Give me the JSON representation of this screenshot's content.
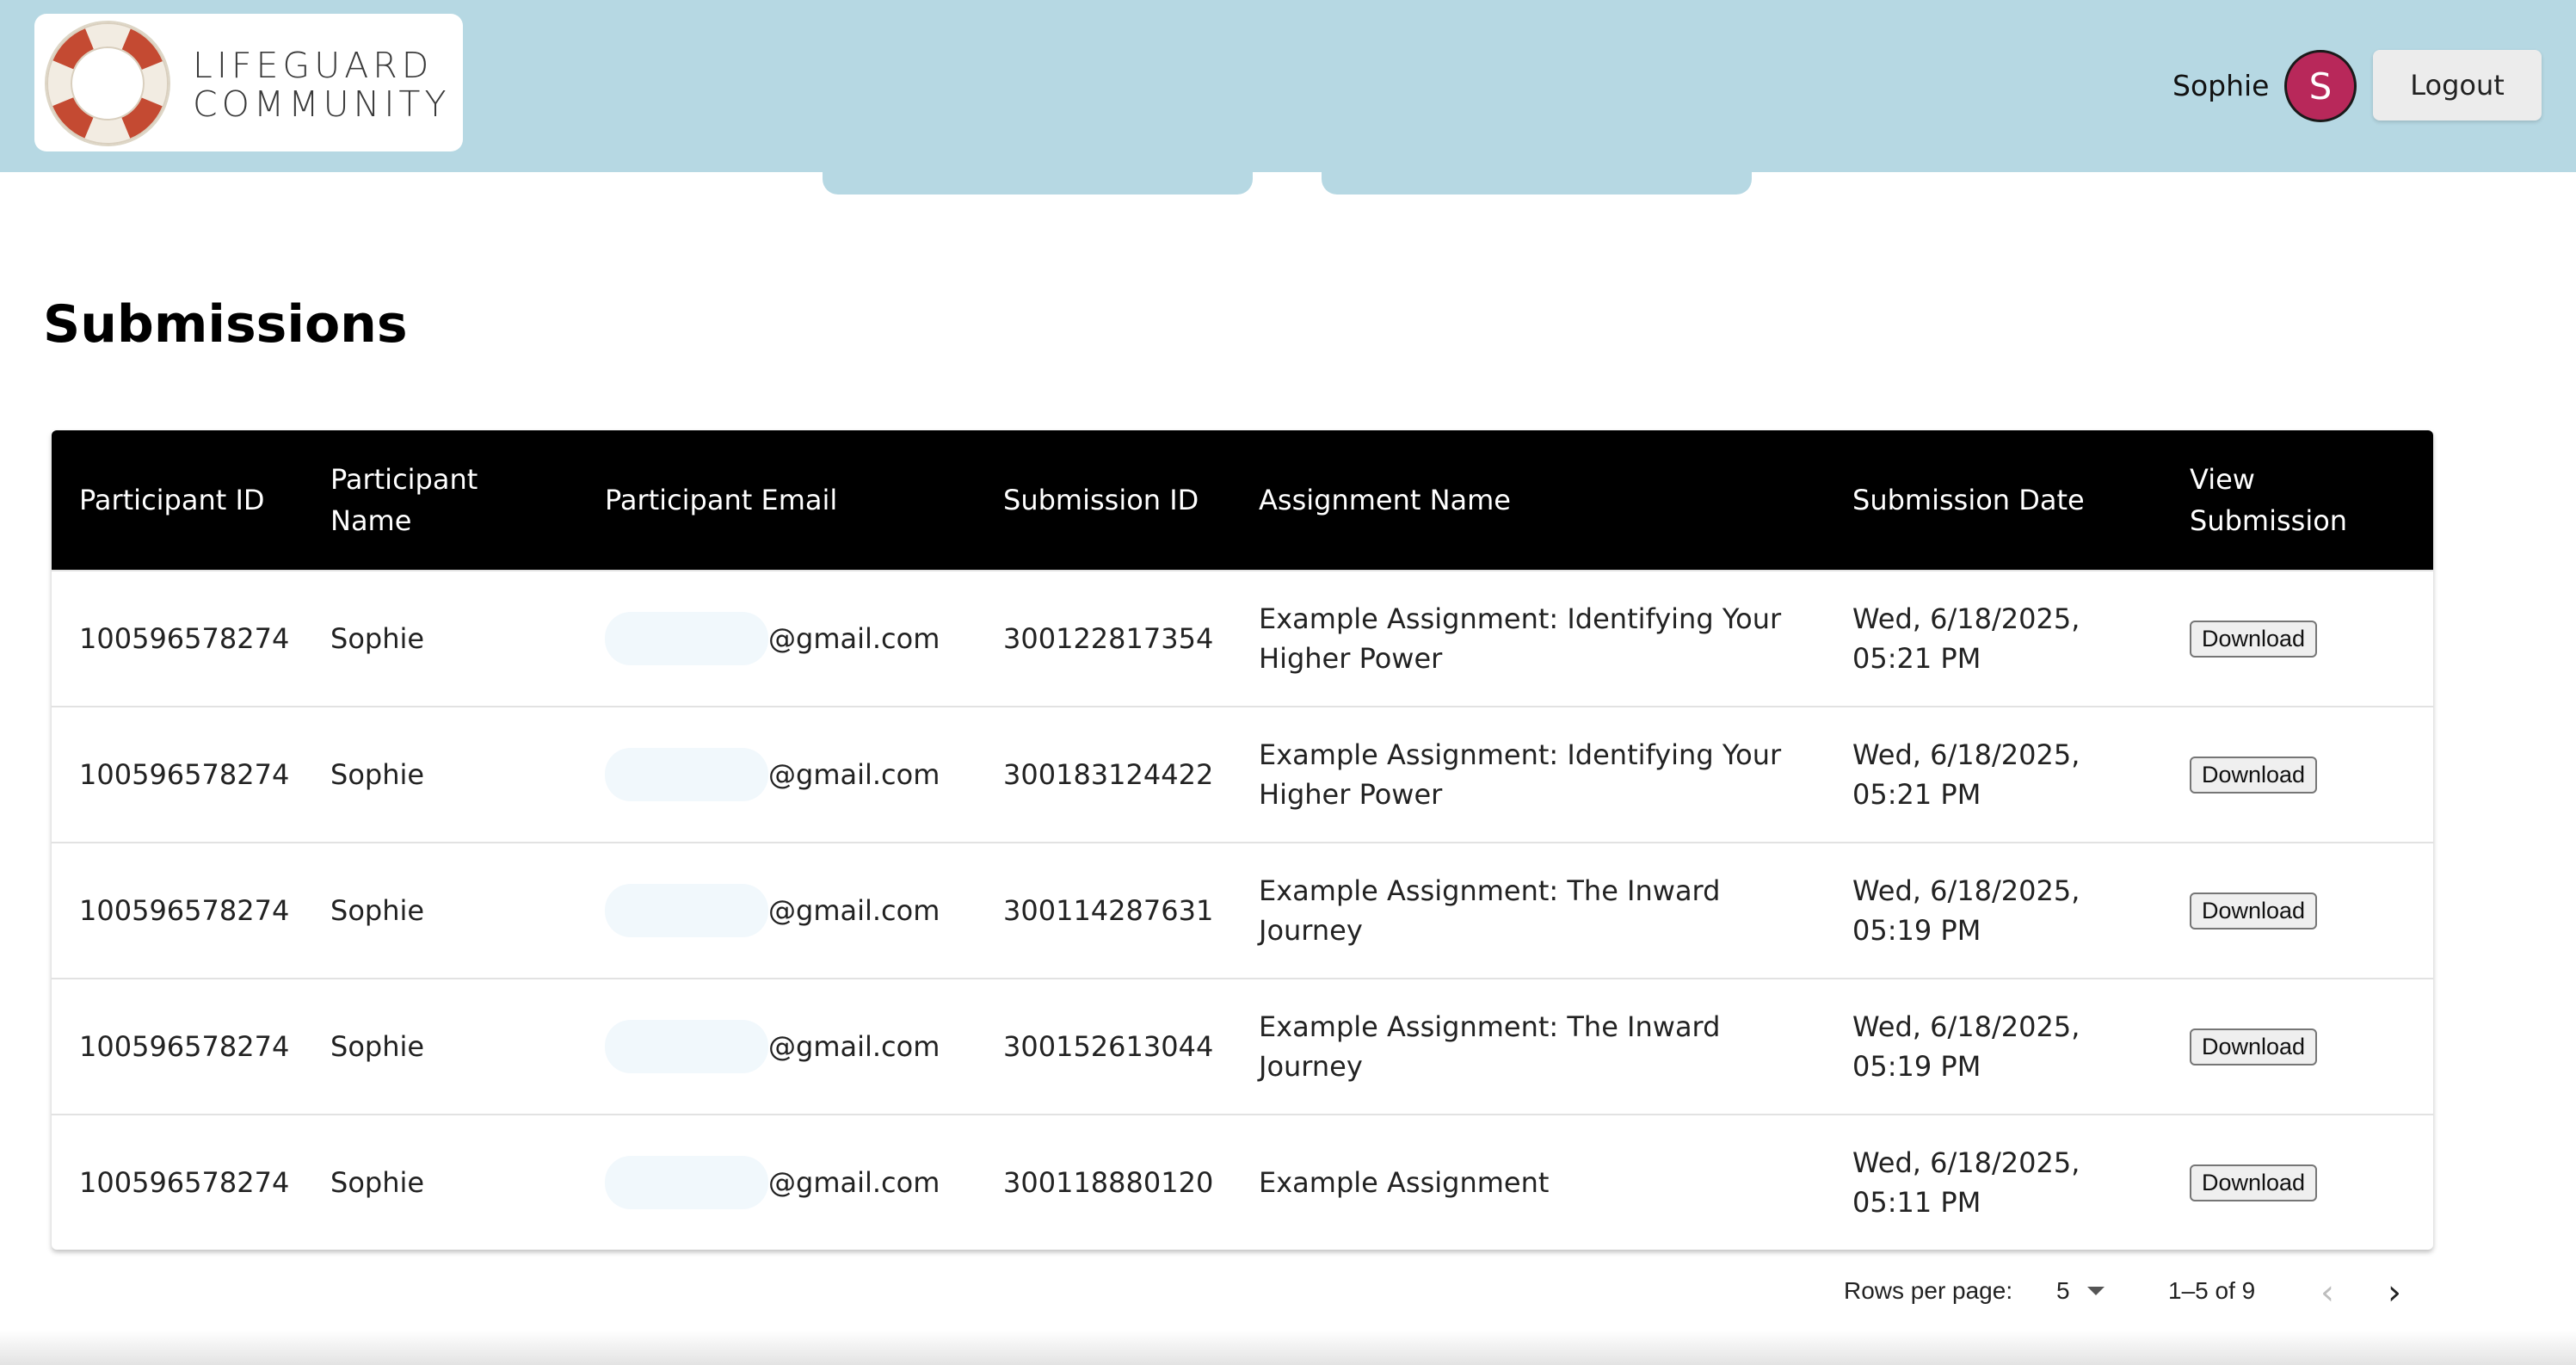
{
  "header": {
    "logo_line1": "LIFEGUARD",
    "logo_line2": "COMMUNITY",
    "user_name": "Sophie",
    "avatar_initial": "S",
    "logout_label": "Logout",
    "colors": {
      "header_bg": "#b6d8e3",
      "avatar_bg": "#b8285a",
      "buoy_red": "#c44a32"
    }
  },
  "page": {
    "title": "Submissions"
  },
  "table": {
    "columns": [
      "Participant ID",
      "Participant Name",
      "Participant Email",
      "Submission ID",
      "Assignment Name",
      "Submission Date",
      "View Submission"
    ],
    "rows": [
      {
        "participant_id": "100596578274",
        "name": "Sophie",
        "email_domain": "@gmail.com",
        "submission_id": "300122817354",
        "assignment": "Example Assignment: Identifying Your Higher Power",
        "date": "Wed, 6/18/2025, 05:21 PM",
        "action": "Download"
      },
      {
        "participant_id": "100596578274",
        "name": "Sophie",
        "email_domain": "@gmail.com",
        "submission_id": "300183124422",
        "assignment": "Example Assignment: Identifying Your Higher Power",
        "date": "Wed, 6/18/2025, 05:21 PM",
        "action": "Download"
      },
      {
        "participant_id": "100596578274",
        "name": "Sophie",
        "email_domain": "@gmail.com",
        "submission_id": "300114287631",
        "assignment": "Example Assignment: The Inward Journey",
        "date": "Wed, 6/18/2025, 05:19 PM",
        "action": "Download"
      },
      {
        "participant_id": "100596578274",
        "name": "Sophie",
        "email_domain": "@gmail.com",
        "submission_id": "300152613044",
        "assignment": "Example Assignment: The Inward Journey",
        "date": "Wed, 6/18/2025, 05:19 PM",
        "action": "Download"
      },
      {
        "participant_id": "100596578274",
        "name": "Sophie",
        "email_domain": "@gmail.com",
        "submission_id": "300118880120",
        "assignment": "Example Assignment",
        "date": "Wed, 6/18/2025, 05:11 PM",
        "action": "Download"
      }
    ]
  },
  "pagination": {
    "rows_label": "Rows per page:",
    "rows_value": "5",
    "range": "1–5 of 9",
    "prev_icon": "chevron-left-icon",
    "next_icon": "chevron-right-icon"
  }
}
